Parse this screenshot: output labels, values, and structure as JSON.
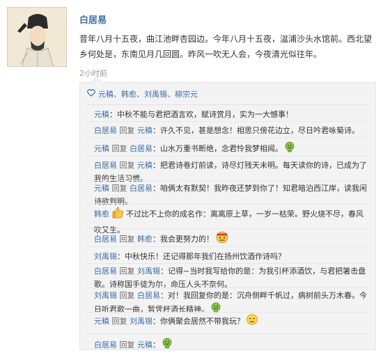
{
  "post": {
    "author": "白居易",
    "text": "昔年八月十五夜，曲江池畔杏园边。今年八月十五夜，湓浦沙头水馆前。西北望乡何处是，东南见月几回圆。昨风一吹无人会，今夜清光似往年。",
    "time": "2小时前"
  },
  "likes": {
    "names": "元稹、韩愈、刘禹锡、柳宗元",
    "color": "#3c6ea5"
  },
  "comments": [
    {
      "from": "元稹",
      "reply_word": "",
      "to": "",
      "colon": "：",
      "text": "中秋不能与君把酒言欢，赋诗赏月，实为一大憾事！",
      "emoji": ""
    },
    {
      "from": "白居易",
      "reply_word": "回复",
      "to": "元稹",
      "colon": "：",
      "text": "许久不见，甚是想念！相思只傍花边立，尽日吟君咏菊诗。",
      "emoji": ""
    },
    {
      "from": "元稹",
      "reply_word": "回复",
      "to": "白居易",
      "colon": "：",
      "text": "山水万重书断绝，念君怜我梦相闻。",
      "emoji": "smile-emoji"
    },
    {
      "from": "白居易",
      "reply_word": "回复",
      "to": "元稹",
      "colon": "：",
      "text": "把君诗卷灯前读，诗尽灯残天未明。每天读你的诗，已成为了我的生活习惯。",
      "emoji": ""
    },
    {
      "from": "元稹",
      "reply_word": "回复",
      "to": "白居易",
      "colon": "：",
      "text": "咱俩太有默契！我昨夜还梦到你了！知君暗泊西江岸，读我闲诗欲到明。",
      "emoji": ""
    },
    {
      "from": "韩愈",
      "reply_word": "",
      "to": "",
      "colon": "：",
      "text": "不过比不上你的成名作：离离原上草，一岁一枯荣。野火烧不尽，春风吹又生。",
      "emoji": "thumbs-up-emoji"
    },
    {
      "from": "白居易",
      "reply_word": "回复",
      "to": "韩愈",
      "colon": "：",
      "text": "我会更努力的！",
      "emoji": "determined-emoji"
    },
    {
      "from": "刘禹锡",
      "reply_word": "",
      "to": "",
      "colon": "：",
      "text": "中秋快乐！还记得那年我们在扬州饮酒作诗吗？",
      "emoji": ""
    },
    {
      "from": "白居易",
      "reply_word": "回复",
      "to": "刘禹锡",
      "colon": "：",
      "text": "记得~当时我写给你的是：为我引杯添酒饮，与君把箸击盘歌。诗称国手徒为尔，命压人头不奈何。",
      "emoji": ""
    },
    {
      "from": "刘禹锡",
      "reply_word": "回复",
      "to": "白居易",
      "colon": "：",
      "text": "对！我回复你的是：沉舟侧畔千帆过，病树前头万木春。今日听君歌一曲，暂凭杯酒长精神。",
      "emoji": "smile-emoji"
    },
    {
      "from": "元稹",
      "reply_word": "回复",
      "to": "刘禹锡",
      "colon": "：",
      "text": "你俩聚会居然不带我玩？",
      "emoji": "sad-emoji"
    },
    {
      "from": "白居易",
      "reply_word": "回复",
      "to": "元稹",
      "colon": "：",
      "text": "",
      "emoji": "smile-emoji"
    }
  ]
}
